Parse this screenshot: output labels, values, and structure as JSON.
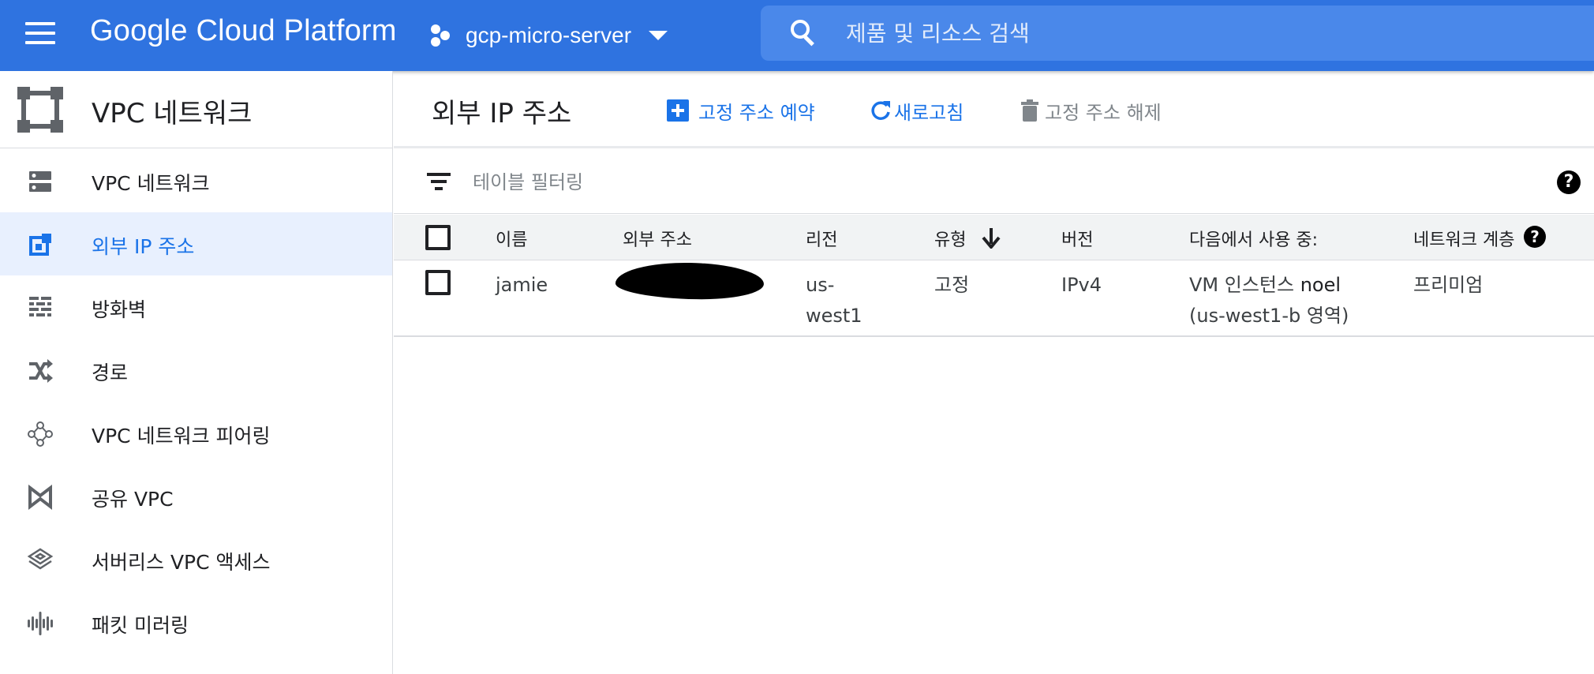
{
  "topbar": {
    "brand": "Google Cloud Platform",
    "project": "gcp-micro-server",
    "search_placeholder": "제품 및 리소스 검색",
    "bg_color": "#2f73e0"
  },
  "sidebar": {
    "title": "VPC 네트워크",
    "items": [
      {
        "label": "VPC 네트워크",
        "icon": "vpc-network-icon",
        "active": false
      },
      {
        "label": "외부 IP 주소",
        "icon": "external-ip-icon",
        "active": true
      },
      {
        "label": "방화벽",
        "icon": "firewall-icon",
        "active": false
      },
      {
        "label": "경로",
        "icon": "routes-icon",
        "active": false
      },
      {
        "label": "VPC 네트워크 피어링",
        "icon": "peering-icon",
        "active": false
      },
      {
        "label": "공유 VPC",
        "icon": "shared-vpc-icon",
        "active": false
      },
      {
        "label": "서버리스 VPC 액세스",
        "icon": "serverless-access-icon",
        "active": false
      },
      {
        "label": "패킷 미러링",
        "icon": "packet-mirroring-icon",
        "active": false
      }
    ]
  },
  "main": {
    "title": "외부 IP 주소",
    "actions": {
      "reserve": "고정 주소 예약",
      "refresh": "새로고침",
      "release": "고정 주소 해제"
    },
    "filter_placeholder": "테이블 필터링"
  },
  "table": {
    "headers": {
      "name": "이름",
      "external_address": "외부 주소",
      "region": "리전",
      "type": "유형",
      "version": "버전",
      "in_use_by": "다음에서 사용 중:",
      "network_tier": "네트워크 계층"
    },
    "rows": [
      {
        "name": "jamie",
        "region_line1": "us-",
        "region_line2": "west1",
        "type": "고정",
        "version": "IPv4",
        "in_use_prefix": "VM 인스턴스",
        "in_use_instance": "noel",
        "in_use_zone": "(us-west1-b 영역)",
        "network_tier": "프리미엄"
      }
    ]
  }
}
